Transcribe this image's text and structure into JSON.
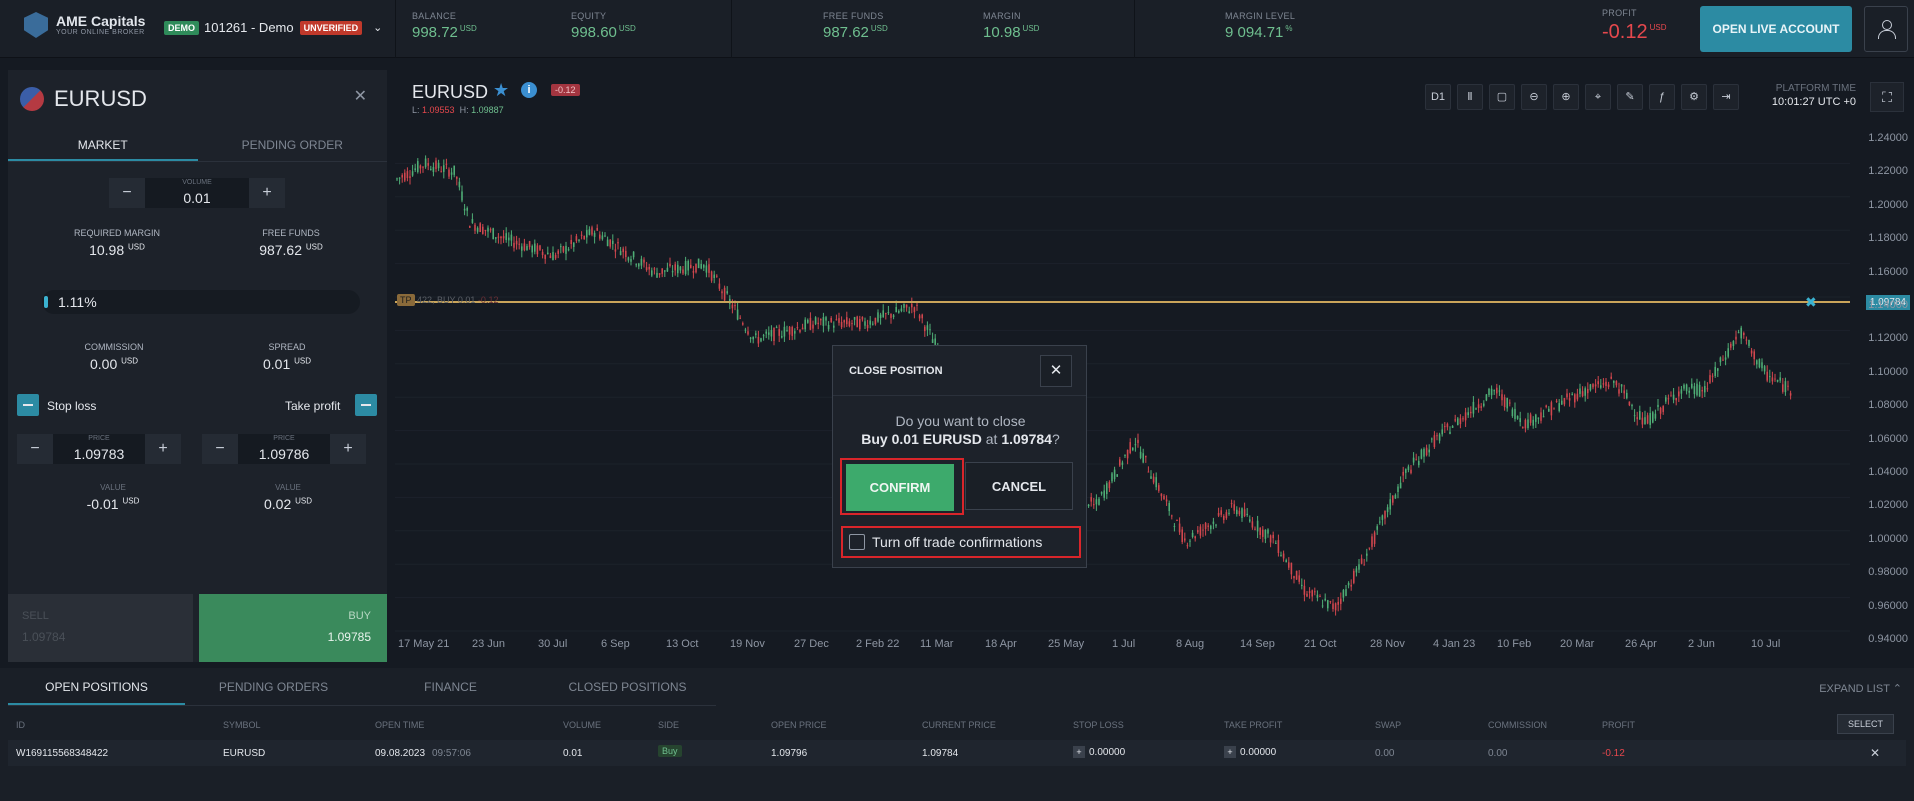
{
  "header": {
    "brand": "AME Capitals",
    "brand_sub": "YOUR ONLINE BROKER",
    "demo_badge": "DEMO",
    "account": "101261 - Demo",
    "unverified_badge": "UNVERIFIED",
    "stats": [
      {
        "label": "BALANCE",
        "value": "998.72",
        "unit": "USD"
      },
      {
        "label": "EQUITY",
        "value": "998.60",
        "unit": "USD"
      },
      {
        "label": "FREE FUNDS",
        "value": "987.62",
        "unit": "USD"
      },
      {
        "label": "MARGIN",
        "value": "10.98",
        "unit": "USD"
      },
      {
        "label": "MARGIN LEVEL",
        "value": "9 094.71",
        "unit": "%"
      }
    ],
    "profit": {
      "label": "PROFIT",
      "value": "-0.12",
      "unit": "USD"
    },
    "live_button": "OPEN LIVE ACCOUNT"
  },
  "order_panel": {
    "symbol": "EURUSD",
    "tabs": [
      "MARKET",
      "PENDING ORDER"
    ],
    "volume_label": "VOLUME",
    "volume": "0.01",
    "required_margin_label": "REQUIRED MARGIN",
    "required_margin": "10.98",
    "free_funds_label": "FREE FUNDS",
    "free_funds": "987.62",
    "unit": "USD",
    "margin_pct": "1.11%",
    "margin_fraction": 0.011,
    "commission_label": "COMMISSION",
    "commission": "0.00",
    "spread_label": "SPREAD",
    "spread": "0.01",
    "stop_loss_label": "Stop loss",
    "take_profit_label": "Take profit",
    "price_label": "PRICE",
    "sl_price": "1.09783",
    "tp_price": "1.09786",
    "value_label": "VALUE",
    "sl_value": "-0.01",
    "tp_value": "0.02",
    "sell_label": "SELL",
    "sell_price": "1.09784",
    "buy_label": "BUY",
    "buy_price": "1.09785"
  },
  "chart": {
    "symbol": "EURUSD",
    "pnl": "-0.12",
    "low_label": "L:",
    "low": "1.09553",
    "high_label": "H:",
    "high": "1.09887",
    "timeframe": "D1",
    "platform_time_label": "PLATFORM TIME",
    "platform_time": "10:01:27 UTC +0",
    "y_ticks": [
      "1.24000",
      "1.22000",
      "1.20000",
      "1.18000",
      "1.16000",
      "1.14000",
      "1.12000",
      "1.10000",
      "1.08000",
      "1.06000",
      "1.04000",
      "1.02000",
      "1.00000",
      "0.98000",
      "0.96000",
      "0.94000"
    ],
    "x_ticks": [
      "17 May 21",
      "23 Jun",
      "30 Jul",
      "6 Sep",
      "13 Oct",
      "19 Nov",
      "27 Dec",
      "2 Feb 22",
      "11 Mar",
      "18 Apr",
      "25 May",
      "1 Jul",
      "8 Aug",
      "14 Sep",
      "21 Oct",
      "28 Nov",
      "4 Jan 23",
      "10 Feb",
      "20 Mar",
      "26 Apr",
      "2 Jun",
      "10 Jul"
    ],
    "tp_tag": "TP",
    "position_line_label": "422, BUY 0.01",
    "position_line_pnl": "-0.12",
    "current_price": "1.09784"
  },
  "modal": {
    "title": "CLOSE POSITION",
    "question": "Do you want to close",
    "detail_side": "Buy 0.01 EURUSD",
    "detail_at": "at",
    "detail_price": "1.09784",
    "detail_end": "?",
    "confirm": "CONFIRM",
    "cancel": "CANCEL",
    "turn_off": "Turn off trade confirmations"
  },
  "bottom": {
    "tabs": [
      "OPEN POSITIONS",
      "PENDING ORDERS",
      "FINANCE",
      "CLOSED POSITIONS"
    ],
    "expand": "EXPAND LIST",
    "columns": [
      "ID",
      "SYMBOL",
      "OPEN TIME",
      "VOLUME",
      "SIDE",
      "OPEN PRICE",
      "CURRENT PRICE",
      "STOP LOSS",
      "TAKE PROFIT",
      "SWAP",
      "COMMISSION",
      "PROFIT"
    ],
    "select": "SELECT",
    "row": {
      "id": "W169115568348422",
      "symbol": "EURUSD",
      "open_date": "09.08.2023",
      "open_time": "09:57:06",
      "volume": "0.01",
      "side": "Buy",
      "open_price": "1.09796",
      "current_price": "1.09784",
      "stop_loss": "0.00000",
      "take_profit": "0.00000",
      "swap": "0.00",
      "commission": "0.00",
      "profit": "-0.12"
    }
  }
}
